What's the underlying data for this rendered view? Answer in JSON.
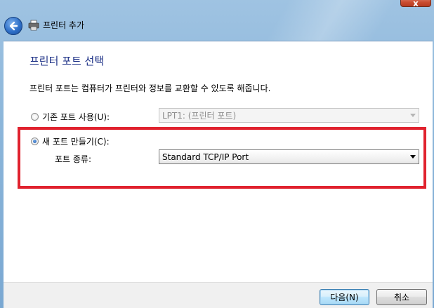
{
  "window": {
    "title": "프린터 추가",
    "close_label": "x"
  },
  "icons": {
    "back": "back-arrow-icon",
    "printer": "printer-icon",
    "close": "close-icon",
    "dropdown": "chevron-down-icon"
  },
  "page": {
    "heading": "프린터 포트 선택",
    "description": "프린터 포트는 컴퓨터가 프린터와 정보를 교환할 수 있도록 해줍니다."
  },
  "options": {
    "existing_port": {
      "label": "기존 포트 사용(U):",
      "selected": false,
      "combo_value": "LPT1: (프린터 포트)",
      "enabled": false
    },
    "new_port": {
      "label": "새 포트 만들기(C):",
      "selected": true,
      "type_label": "포트 종류:",
      "combo_value": "Standard TCP/IP Port",
      "enabled": true
    }
  },
  "footer": {
    "next_label": "다음(N)",
    "cancel_label": "취소"
  },
  "colors": {
    "heading": "#1e3287",
    "highlight": "#e0222e",
    "chrome": "#8cb6da"
  }
}
